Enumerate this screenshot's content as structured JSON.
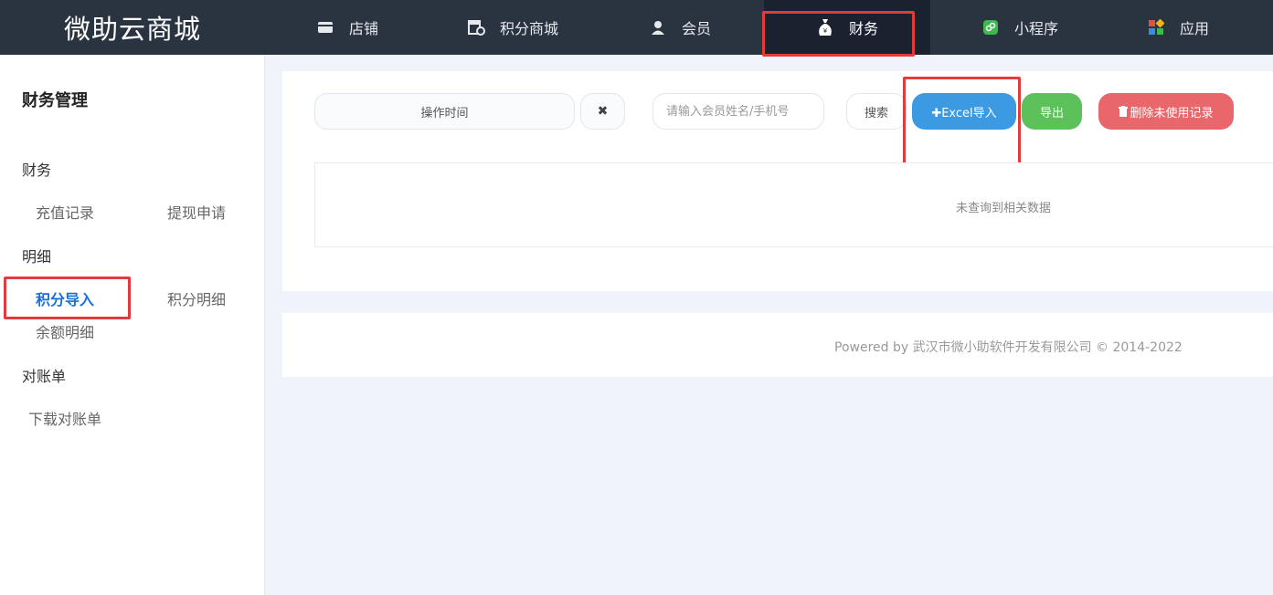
{
  "app": {
    "logo": "微助云商城"
  },
  "nav": {
    "items": [
      {
        "label": "店铺",
        "icon": "store-icon"
      },
      {
        "label": "积分商城",
        "icon": "points-mall-icon"
      },
      {
        "label": "会员",
        "icon": "user-icon"
      },
      {
        "label": "财务",
        "icon": "money-bag-icon",
        "active": true
      },
      {
        "label": "小程序",
        "icon": "mini-program-icon"
      },
      {
        "label": "应用",
        "icon": "apps-icon"
      }
    ]
  },
  "sidebar": {
    "title": "财务管理",
    "groups": [
      {
        "label": "财务",
        "items": [
          "充值记录",
          "提现申请"
        ]
      },
      {
        "label": "明细",
        "items": [
          "积分导入",
          "积分明细",
          "余额明细"
        ]
      },
      {
        "label": "对账单",
        "items": [
          "下载对账单"
        ]
      }
    ]
  },
  "toolbar": {
    "time_label": "操作时间",
    "clear_symbol": "✖",
    "search_placeholder": "请输入会员姓名/手机号",
    "search_label": "搜索",
    "import_label": "✚Excel导入",
    "export_label": "导出",
    "delete_label": "删除未使用记录"
  },
  "table": {
    "empty_text": "未查询到相关数据"
  },
  "footer": {
    "text": "Powered by 武汉市微小助软件开发有限公司 © 2014-2022"
  },
  "colors": {
    "topbar": "#2a3441",
    "primary": "#3b9ae1",
    "success": "#5cc15a",
    "danger": "#e9666a",
    "highlight": "#e23b3b",
    "active_link": "#1b6fd6"
  }
}
